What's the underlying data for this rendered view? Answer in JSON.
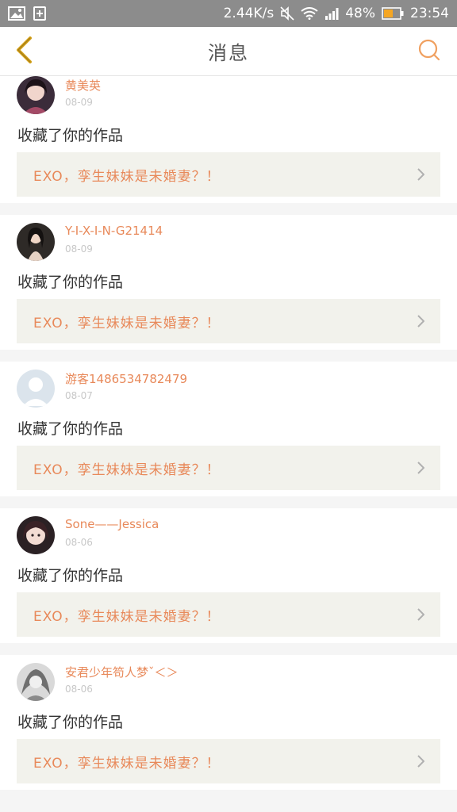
{
  "status_bar": {
    "net_speed": "2.44K/s",
    "battery": "48%",
    "time": "23:54",
    "icons": [
      "gallery-icon",
      "add-box-icon",
      "mute-icon",
      "wifi-icon",
      "signal-icon",
      "battery-icon"
    ]
  },
  "header": {
    "title": "消息",
    "back_icon": "chevron-left-icon",
    "search_icon": "search-icon"
  },
  "colors": {
    "accent": "#e8895a",
    "back": "#d4a017",
    "card_link_bg": "#f2f2ec",
    "statusbar": "#8c8c8c"
  },
  "notifications": [
    {
      "username": "黄美英",
      "date": "08-09",
      "action": "收藏了你的作品",
      "work_title": "EXO，孪生妹妹是未婚妻？！"
    },
    {
      "username": "Y-I-X-I-N-G21414",
      "date": "08-09",
      "action": "收藏了你的作品",
      "work_title": "EXO，孪生妹妹是未婚妻？！"
    },
    {
      "username": "游客1486534782479",
      "date": "08-07",
      "action": "收藏了你的作品",
      "work_title": "EXO，孪生妹妹是未婚妻？！"
    },
    {
      "username": "Sone——Jessica",
      "date": "08-06",
      "action": "收藏了你的作品",
      "work_title": "EXO，孪生妹妹是未婚妻？！"
    },
    {
      "username": "安君少年笱人梦ˇ＜＞",
      "date": "08-06",
      "action": "收藏了你的作品",
      "work_title": "EXO，孪生妹妹是未婚妻？！"
    }
  ]
}
